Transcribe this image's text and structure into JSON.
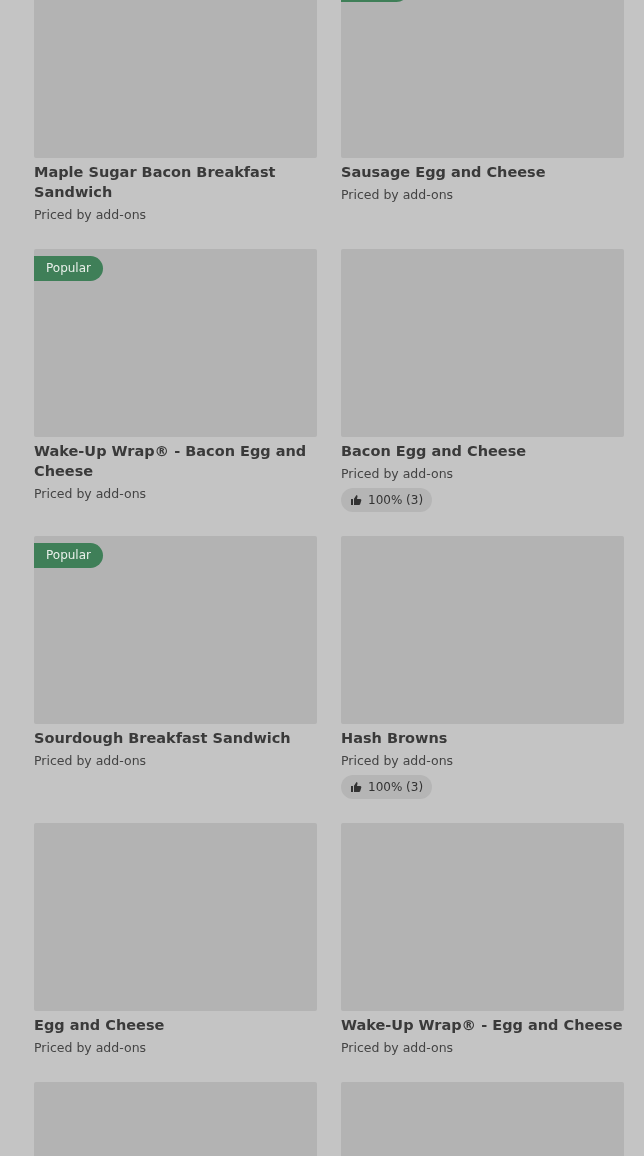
{
  "menu_items": [
    {
      "title": "Maple Sugar Bacon Breakfast Sandwich",
      "price": "Priced by add-ons",
      "badge": false
    },
    {
      "title": "Sausage Egg and Cheese",
      "price": "Priced by add-ons",
      "badge": true
    },
    {
      "title": "Wake-Up Wrap® - Bacon Egg and Cheese",
      "price": "Priced by add-ons",
      "badge": true,
      "badge_label": "Popular"
    },
    {
      "title": "Bacon Egg and Cheese",
      "price": "Priced by add-ons",
      "badge": false,
      "rating": "100% (3)"
    },
    {
      "title": "Sourdough Breakfast Sandwich",
      "price": "Priced by add-ons",
      "badge": true,
      "badge_label": "Popular"
    },
    {
      "title": "Hash Browns",
      "price": "Priced by add-ons",
      "badge": false,
      "rating": "100% (3)"
    },
    {
      "title": "Egg and Cheese",
      "price": "Priced by add-ons",
      "badge": false
    },
    {
      "title": "Wake-Up Wrap® - Egg and Cheese",
      "price": "Priced by add-ons",
      "badge": false
    },
    {
      "badge": false
    },
    {
      "badge": false
    }
  ]
}
